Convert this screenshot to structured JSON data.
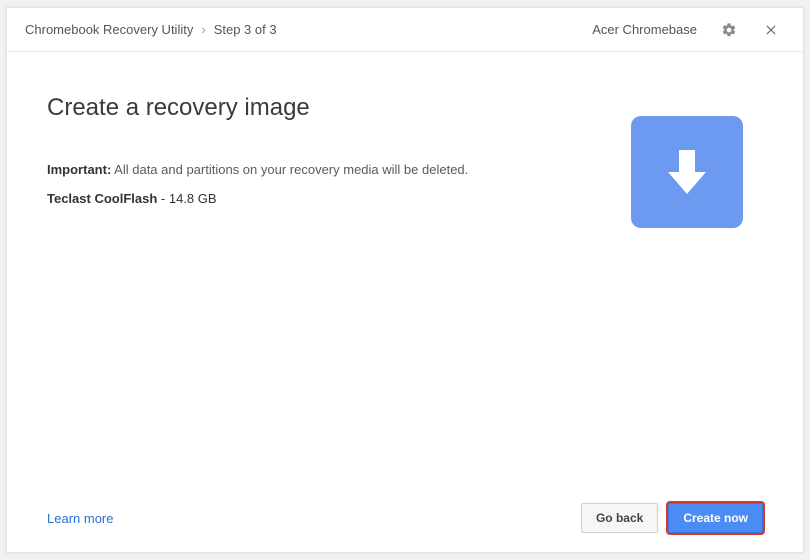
{
  "titlebar": {
    "app": "Chromebook Recovery Utility",
    "chevron": "›",
    "step": "Step 3 of 3",
    "device": "Acer Chromebase"
  },
  "main": {
    "heading": "Create a recovery image",
    "important_label": "Important:",
    "important_text": " All data and partitions on your recovery media will be deleted.",
    "media_name": "Teclast CoolFlash",
    "media_sep": " - ",
    "media_size": "14.8 GB"
  },
  "footer": {
    "learn_more": "Learn more",
    "go_back": "Go back",
    "create_now": "Create now"
  }
}
